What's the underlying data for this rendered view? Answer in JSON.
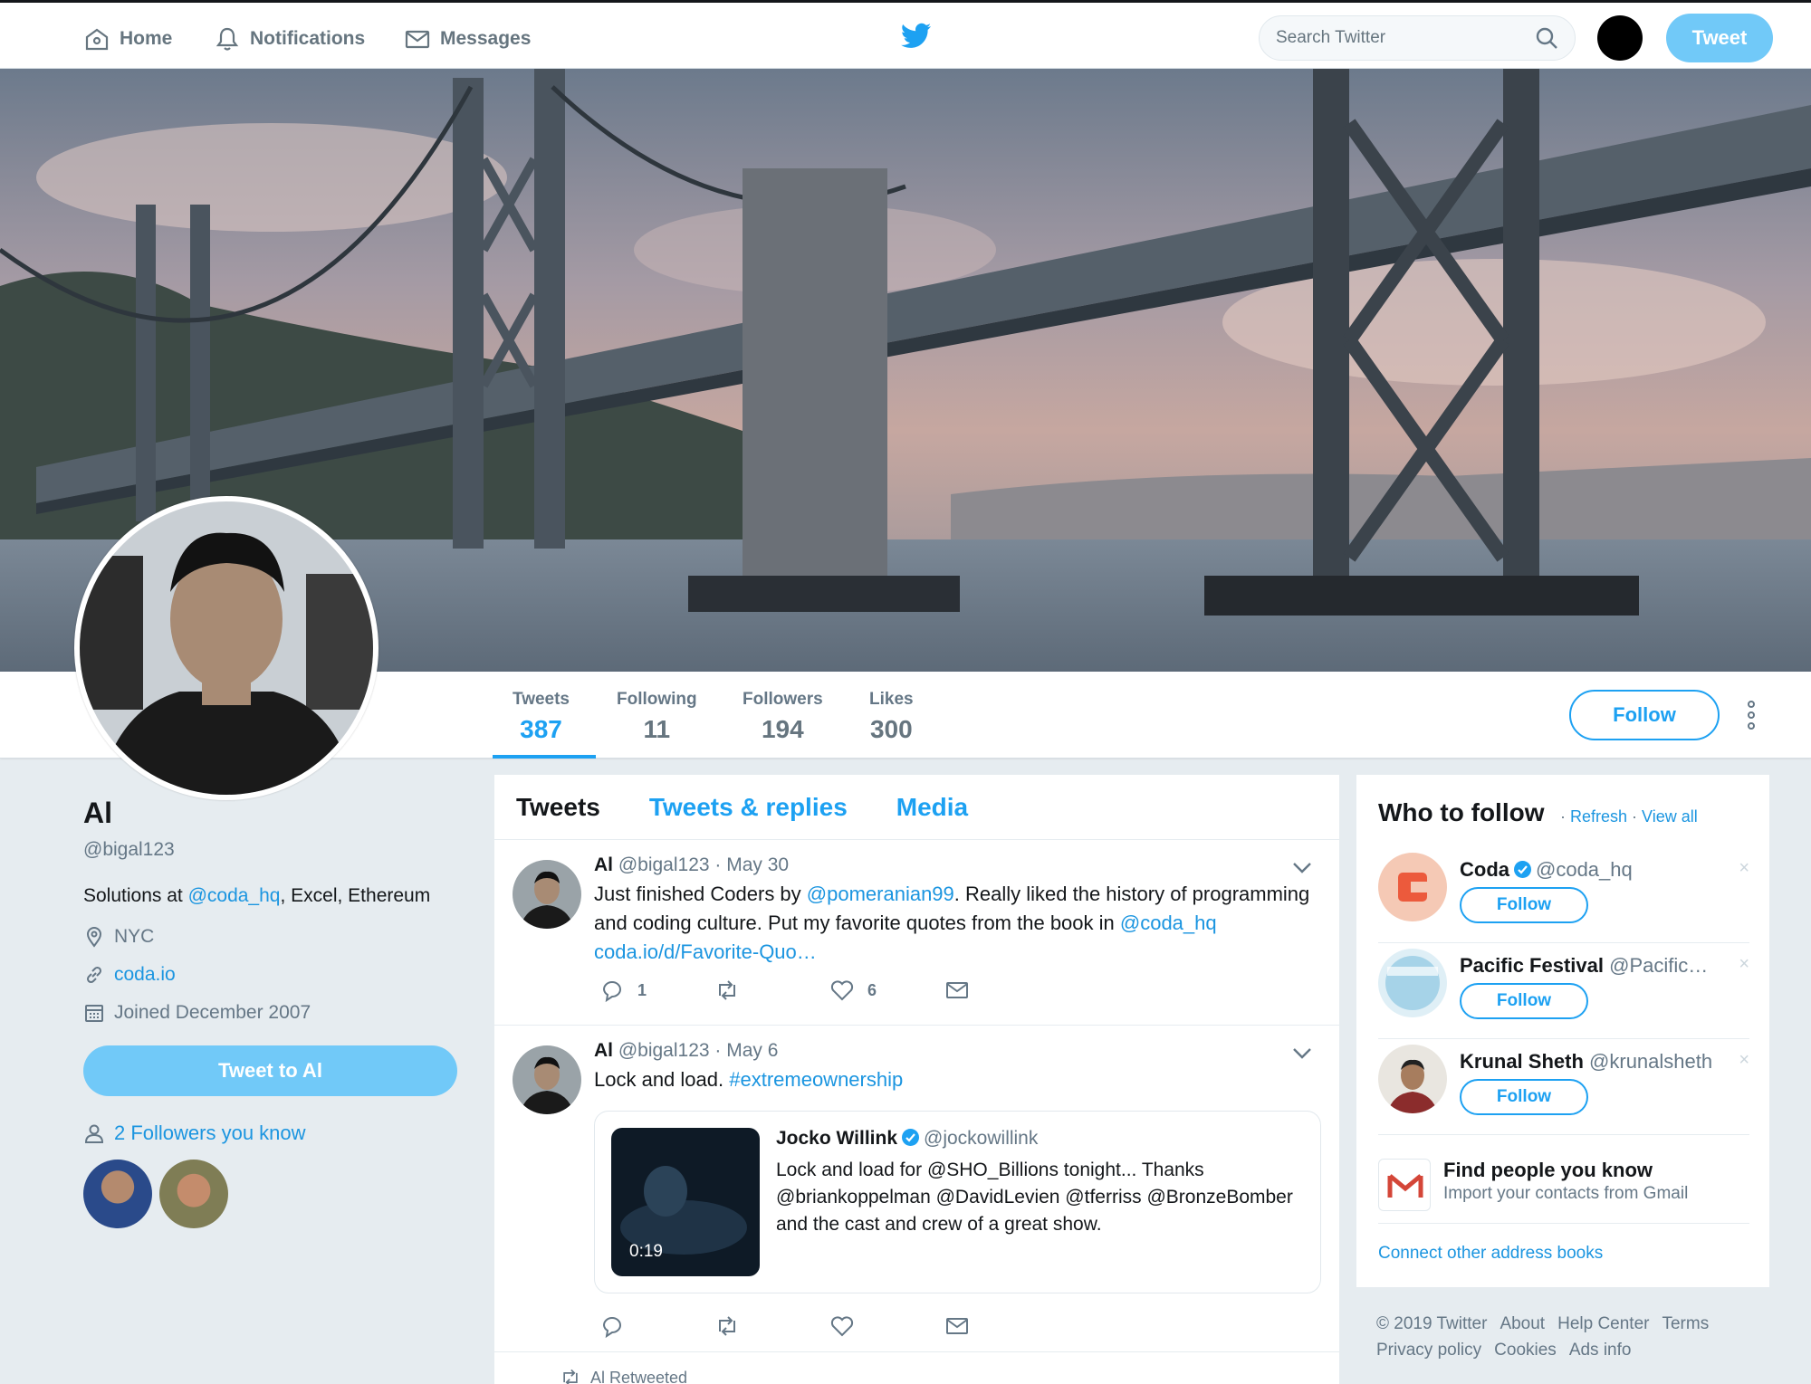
{
  "nav": {
    "home": "Home",
    "notifications": "Notifications",
    "messages": "Messages",
    "search_placeholder": "Search Twitter",
    "tweet_button": "Tweet"
  },
  "profile": {
    "name": "Al",
    "handle": "@bigal123",
    "bio_prefix": "Solutions at ",
    "bio_link": "@coda_hq",
    "bio_suffix": ", Excel, Ethereum",
    "location": "NYC",
    "website": "coda.io",
    "joined": "Joined December 2007",
    "tweet_to": "Tweet to Al",
    "followers_you_know": "2 Followers you know"
  },
  "stats": {
    "tweets_label": "Tweets",
    "tweets": "387",
    "following_label": "Following",
    "following": "11",
    "followers_label": "Followers",
    "followers": "194",
    "likes_label": "Likes",
    "likes": "300",
    "follow_button": "Follow"
  },
  "timeline": {
    "tabs": [
      "Tweets",
      "Tweets & replies",
      "Media"
    ],
    "tweets": [
      {
        "name": "Al",
        "handle": "@bigal123",
        "date": "· May 30",
        "text_1": "Just finished Coders by ",
        "link_1": "@pomeranian99",
        "text_2": ". Really liked the history of programming and coding culture. Put my favorite quotes from the book in ",
        "link_2": "@coda_hq",
        "link_3": "coda.io/d/Favorite-Quo…",
        "replies": "1",
        "likes": "6"
      },
      {
        "name": "Al",
        "handle": "@bigal123",
        "date": "· May 6",
        "text_1": "Lock and load. ",
        "link_1": "#extremeownership",
        "quote_name": "Jocko Willink",
        "quote_handle": "@jockowillink",
        "quote_text": "Lock and load for @SHO_Billions tonight... Thanks @briankoppelman @DavidLevien @tferriss @BronzeBomber and the cast and crew of a great show.",
        "video_duration": "0:19"
      }
    ],
    "retweeted": "Al Retweeted"
  },
  "who_to_follow": {
    "title": "Who to follow",
    "refresh": "Refresh",
    "view_all": "View all",
    "suggestions": [
      {
        "name": "Coda",
        "handle": "@coda_hq",
        "verified": true,
        "follow": "Follow"
      },
      {
        "name": "Pacific Festival",
        "handle": "@Pacific…",
        "verified": false,
        "follow": "Follow"
      },
      {
        "name": "Krunal Sheth",
        "handle": "@krunalsheth",
        "verified": false,
        "follow": "Follow"
      }
    ],
    "find_title": "Find people you know",
    "find_sub": "Import your contacts from Gmail",
    "connect": "Connect other address books"
  },
  "footer": {
    "links": [
      "© 2019 Twitter",
      "About",
      "Help Center",
      "Terms",
      "Privacy policy",
      "Cookies",
      "Ads info"
    ]
  },
  "colors": {
    "accent": "#1da1f2",
    "link": "#1b95e0",
    "tweet_button": "#71c9f8",
    "background": "#e6ecf0"
  }
}
